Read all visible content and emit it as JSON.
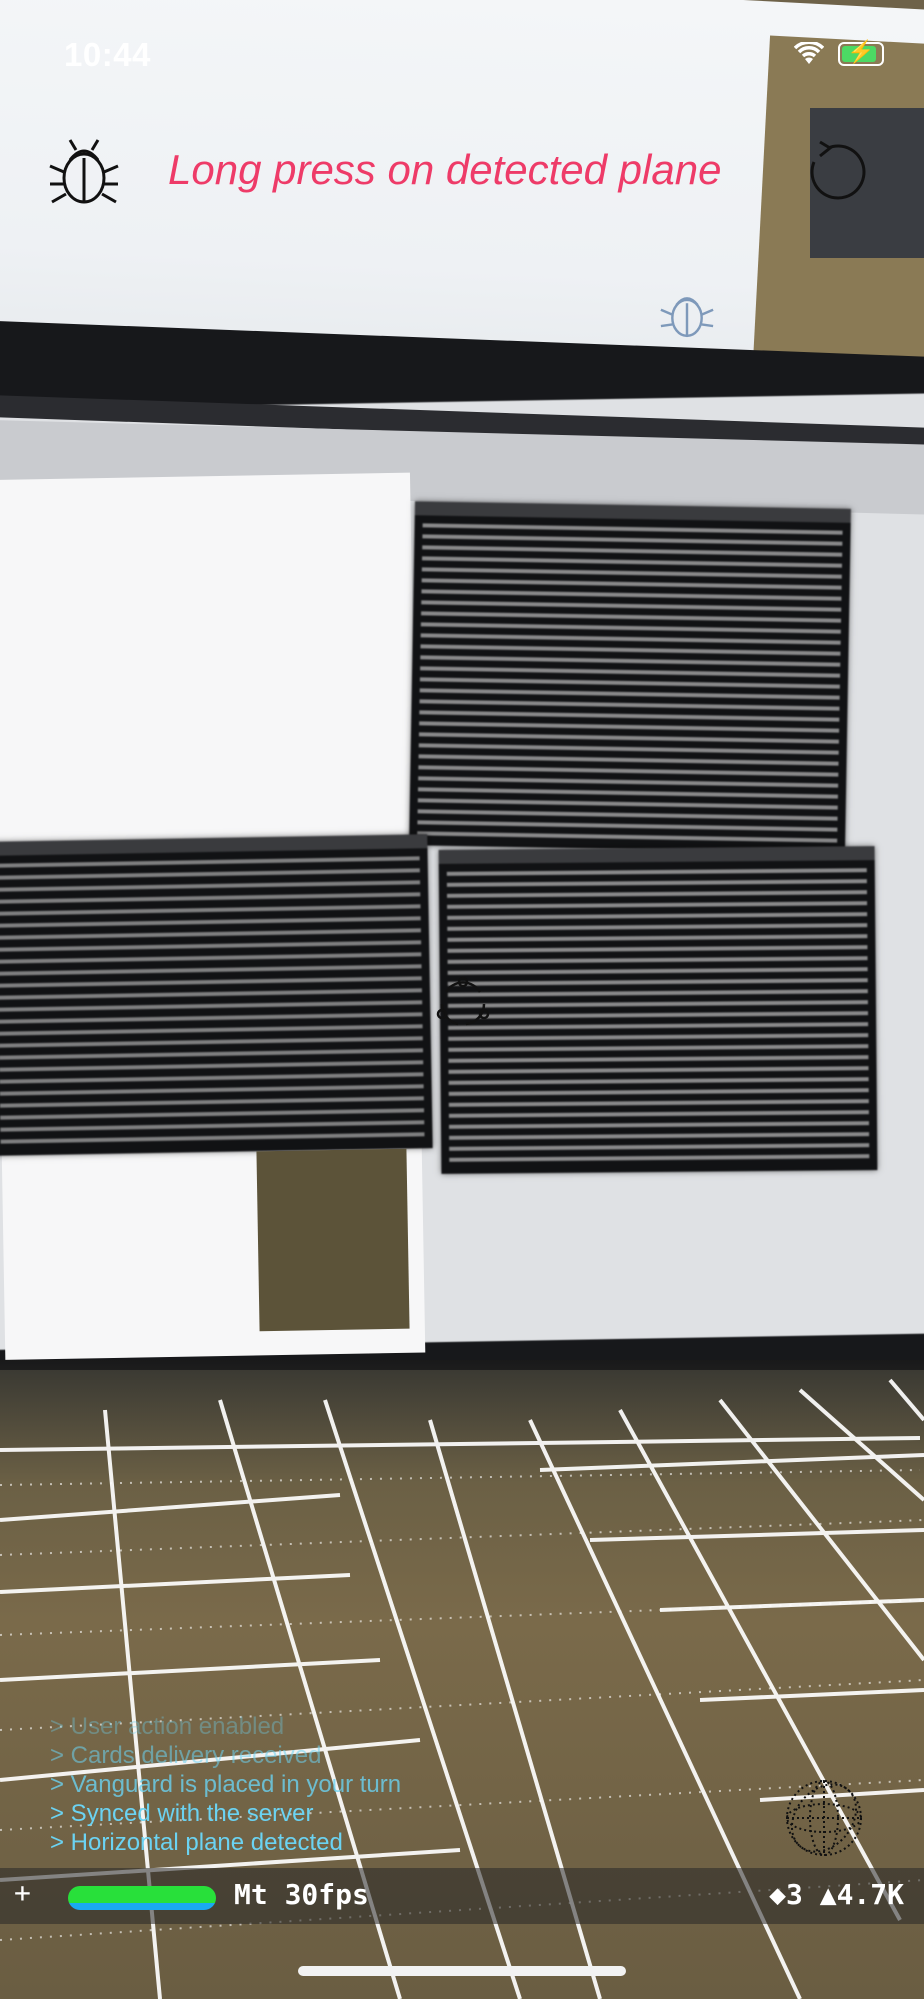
{
  "status_bar": {
    "time": "10:44",
    "icons": [
      "wifi-icon",
      "charging-battery-icon"
    ],
    "battery_color": "#4cd964"
  },
  "overlay": {
    "debug_button_icon": "ladybug-icon",
    "hint": "Long press on detected plane",
    "hint_color": "#ee3b68",
    "reset_button_icon": "rotate-arrow-icon",
    "place_button_icon": "wireframe-sphere-icon"
  },
  "log": [
    "> User action enabled",
    "> Cards delivery received",
    "> Vanguard is placed in your turn",
    "> Synced with the server",
    "> Horizontal plane detected"
  ],
  "log_color": "#6bd3f2",
  "stats": {
    "plus": "+",
    "fps": "Mt 30fps",
    "nodes": "◆3 ▲4.7K"
  }
}
